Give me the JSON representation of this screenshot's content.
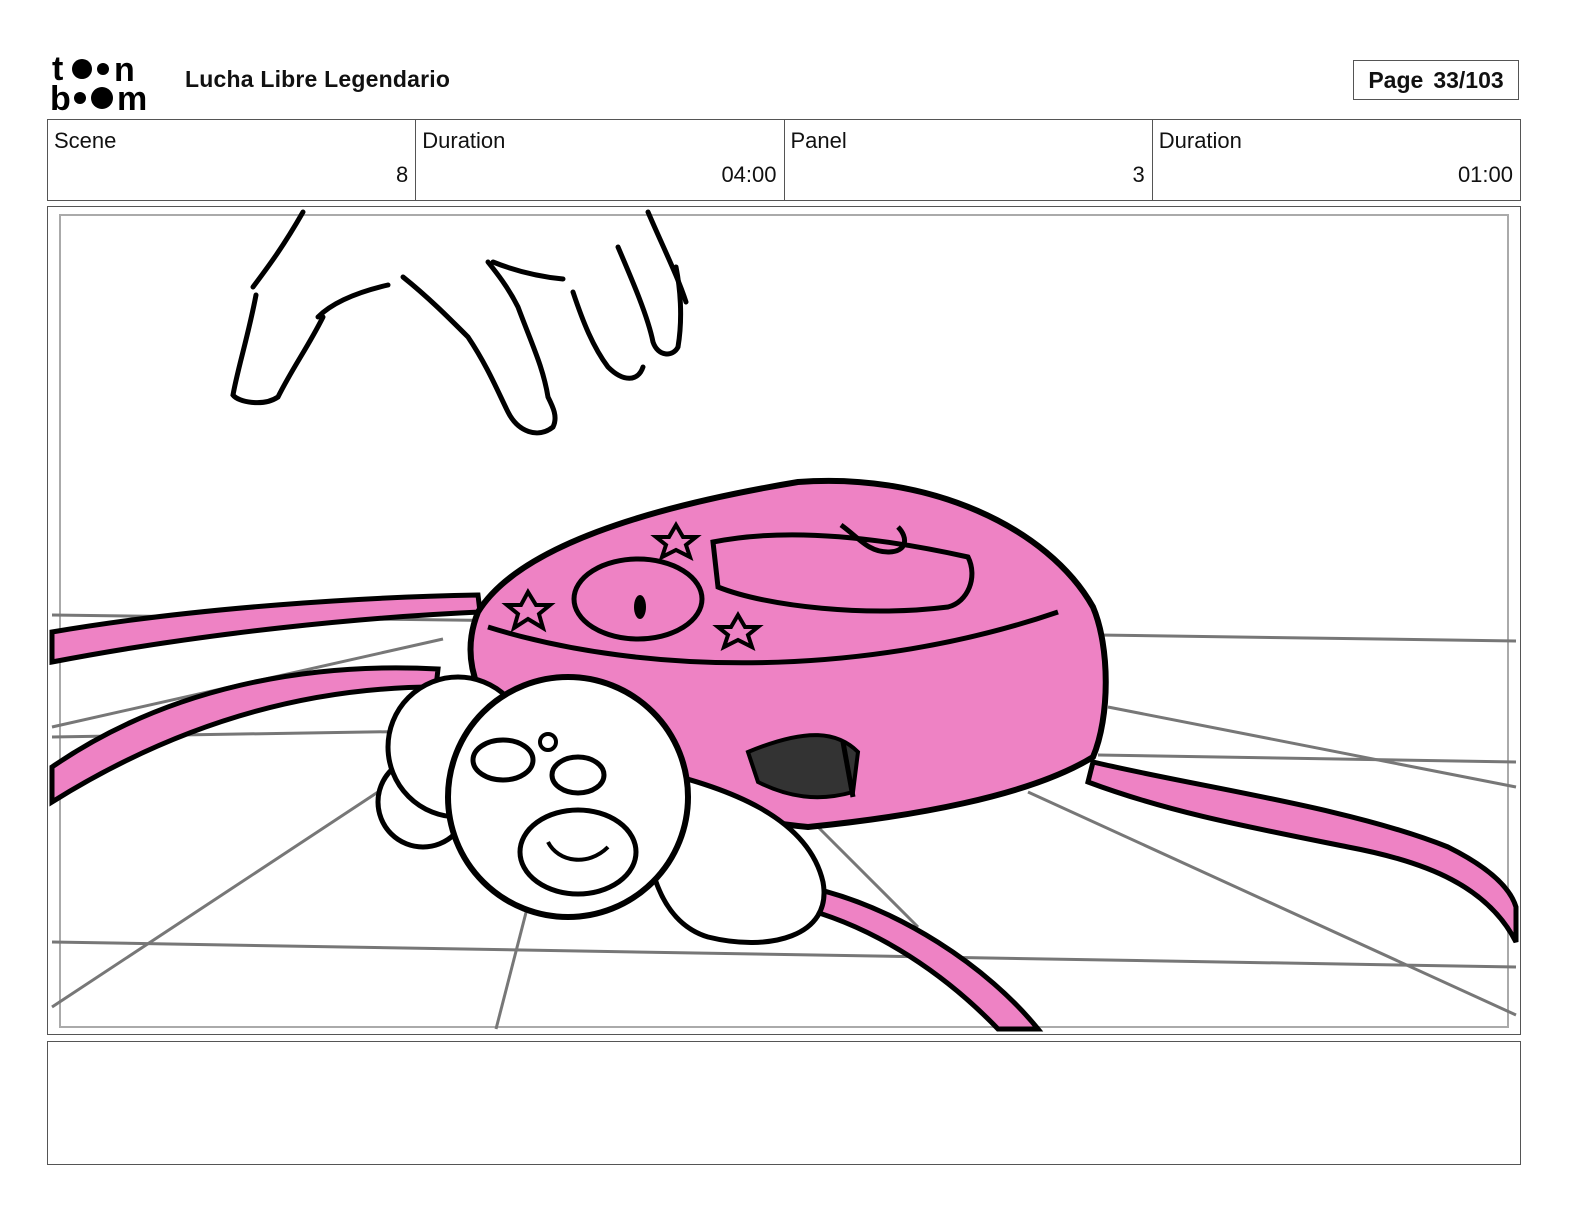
{
  "header": {
    "logo": {
      "top": "to•n",
      "bottom": "b••m",
      "icon": "toonboom-logo"
    },
    "project_title": "Lucha Libre Legendario",
    "page_label": "Page",
    "page_value": "33/103"
  },
  "info_bar": [
    {
      "label": "Scene",
      "value": "8"
    },
    {
      "label": "Duration",
      "value": "04:00"
    },
    {
      "label": "Panel",
      "value": "3"
    },
    {
      "label": "Duration",
      "value": "01:00"
    }
  ],
  "panel": {
    "image": "sketch-hand-reaching-pink-backpack-plush-toy-on-tiled-floor",
    "accent_color": "#ee82c4"
  },
  "notes": {
    "text": ""
  }
}
